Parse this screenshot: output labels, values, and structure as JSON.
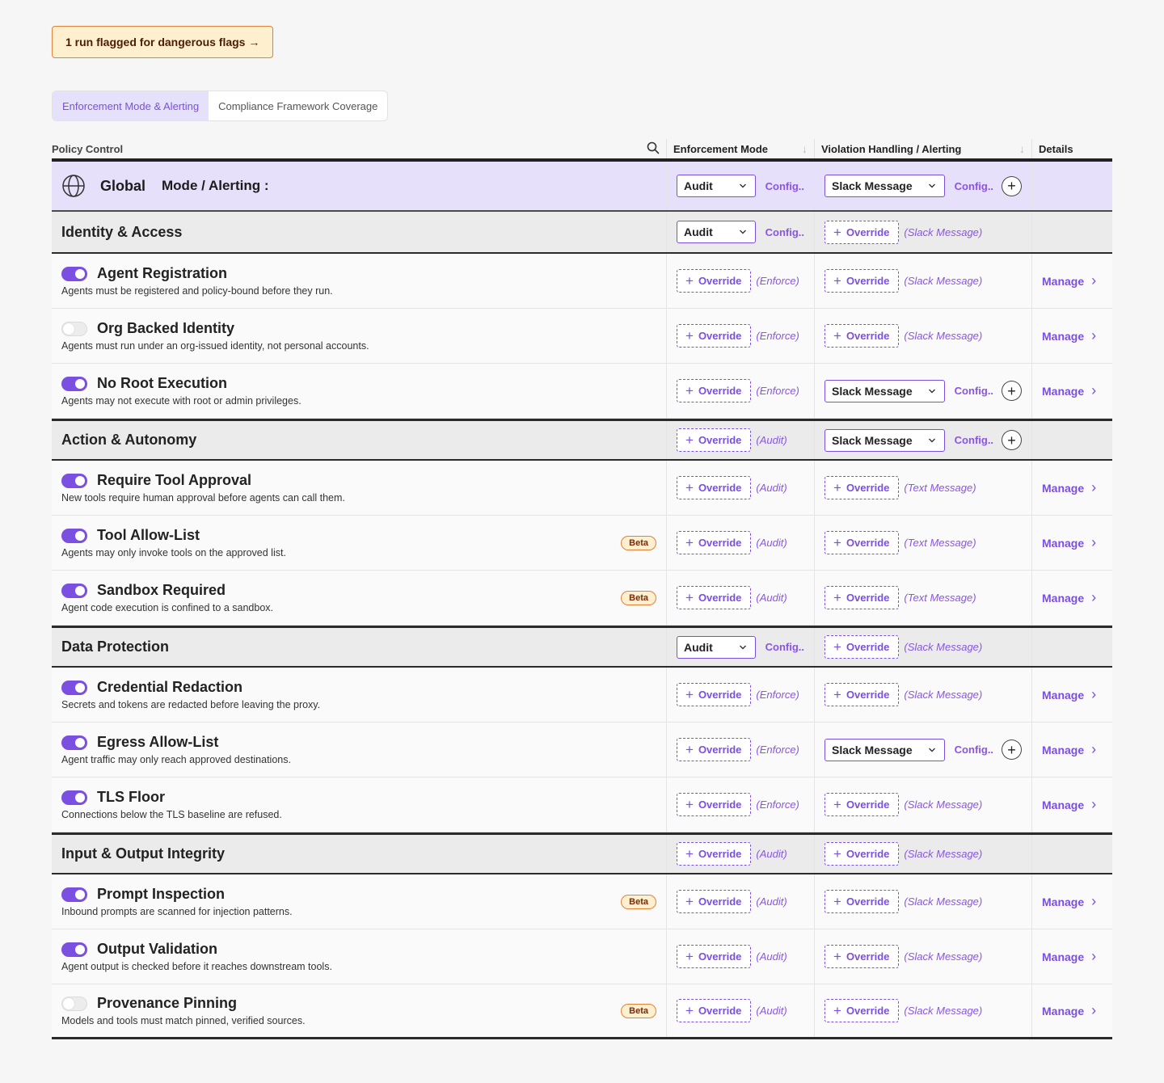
{
  "banner": {
    "label": "1 run flagged for dangerous flags →"
  },
  "tabs": [
    {
      "label": "Enforcement Mode & Alerting"
    },
    {
      "label": "Compliance Framework Coverage"
    }
  ],
  "table": {
    "headers": {
      "policy": "Policy Control",
      "mode": "Enforcement Mode",
      "alerting": "Violation Handling / Alerting",
      "details": "Details"
    },
    "common": {
      "override": "Override",
      "config": "Config..",
      "manage": "Manage",
      "beta": "Beta"
    },
    "global": {
      "title": "Global",
      "subtitle": "Mode / Alerting :",
      "mode": "Audit",
      "alert": "Slack Message"
    },
    "sections": [
      {
        "title": "Identity & Access",
        "mode": "Audit",
        "alert_hint": "(Slack Message)",
        "policies": [
          {
            "title": "Agent Registration",
            "desc": "Agents must be registered and policy-bound before they run.",
            "mode_hint": "(Enforce)",
            "alert_hint": "(Slack Message)"
          },
          {
            "title": "Org Backed Identity",
            "desc": "Agents must run under an org-issued identity, not personal accounts.",
            "mode_hint": "(Enforce)",
            "alert_hint": "(Slack Message)"
          },
          {
            "title": "No Root Execution",
            "desc": "Agents may not execute with root or admin privileges.",
            "mode_hint": "(Enforce)",
            "alert_select": "Slack Message"
          }
        ]
      },
      {
        "title": "Action & Autonomy",
        "mode_hint": "(Audit)",
        "alert_select": "Slack Message",
        "policies": [
          {
            "title": "Require Tool Approval",
            "desc": "New tools require human approval before agents can call them.",
            "mode_hint": "(Audit)",
            "alert_hint": "(Text Message)"
          },
          {
            "title": "Tool Allow-List",
            "desc": "Agents may only invoke tools on the approved list.",
            "mode_hint": "(Audit)",
            "alert_hint": "(Text Message)"
          },
          {
            "title": "Sandbox Required",
            "desc": "Agent code execution is confined to a sandbox.",
            "mode_hint": "(Audit)",
            "alert_hint": "(Text Message)"
          }
        ]
      },
      {
        "title": "Data Protection",
        "mode": "Audit",
        "alert_hint": "(Slack Message)",
        "policies": [
          {
            "title": "Credential Redaction",
            "desc": "Secrets and tokens are redacted before leaving the proxy.",
            "mode_hint": "(Enforce)",
            "alert_hint": "(Slack Message)"
          },
          {
            "title": "Egress Allow-List",
            "desc": "Agent traffic may only reach approved destinations.",
            "mode_hint": "(Enforce)",
            "alert_select": "Slack Message"
          },
          {
            "title": "TLS Floor",
            "desc": "Connections below the TLS baseline are refused.",
            "mode_hint": "(Enforce)",
            "alert_hint": "(Slack Message)"
          }
        ]
      },
      {
        "title": "Input & Output Integrity",
        "mode_hint": "(Audit)",
        "alert_hint": "(Slack Message)",
        "policies": [
          {
            "title": "Prompt Inspection",
            "desc": "Inbound prompts are scanned for injection patterns.",
            "mode_hint": "(Audit)",
            "alert_hint": "(Slack Message)"
          },
          {
            "title": "Output Validation",
            "desc": "Agent output is checked before it reaches downstream tools.",
            "mode_hint": "(Audit)",
            "alert_hint": "(Slack Message)"
          },
          {
            "title": "Provenance Pinning",
            "desc": "Models and tools must match pinned, verified sources.",
            "mode_hint": "(Audit)",
            "alert_hint": "(Slack Message)"
          }
        ]
      }
    ]
  }
}
